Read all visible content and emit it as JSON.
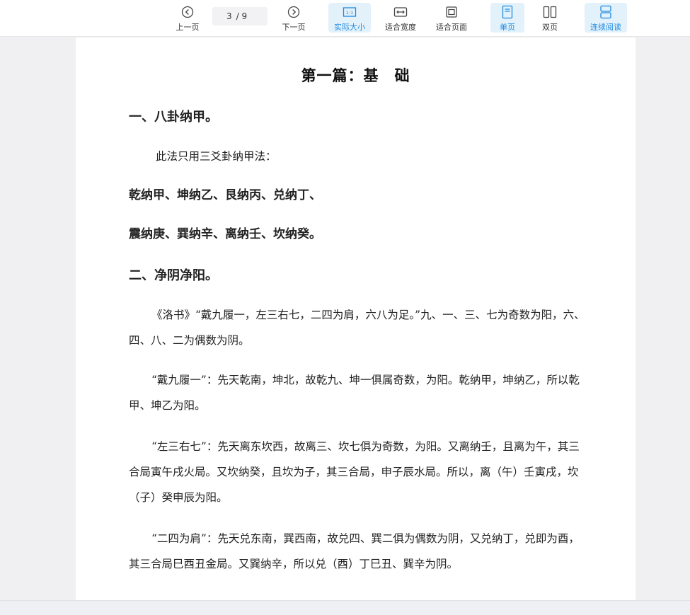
{
  "toolbar": {
    "prev_label": "上一页",
    "next_label": "下一页",
    "current_page": "3",
    "total_pages": "/ 9",
    "actual_size_label": "实际大小",
    "fit_width_label": "适合宽度",
    "fit_page_label": "适合页面",
    "single_page_label": "单页",
    "double_page_label": "双页",
    "continuous_label": "连续阅读",
    "actual_size_icon_text": "1:1",
    "accent_color": "#1e8be0"
  },
  "document": {
    "title": "第一篇：基　础",
    "section1_heading": "一、八卦纳甲。",
    "section1_intro": "此法只用三爻卦纳甲法：",
    "section1_line1": "乾纳甲、坤纳乙、艮纳丙、兑纳丁、",
    "section1_line2": "震纳庚、巽纳辛、离纳壬、坎纳癸。",
    "section2_heading": "二、净阴净阳。",
    "para1": "《洛书》“戴九履一，左三右七，二四为肩，六八为足。”九、一、三、七为奇数为阳，六、四、八、二为偶数为阴。",
    "para2": "“戴九履一”：先天乾南，坤北，故乾九、坤一俱属奇数，为阳。乾纳甲，坤纳乙，所以乾甲、坤乙为阳。",
    "para3": "“左三右七”：先天离东坎西，故离三、坎七俱为奇数，为阳。又离纳壬，且离为午，其三合局寅午戌火局。又坎纳癸，且坎为子，其三合局，申子辰水局。所以，离（午）壬寅戌，坎（子）癸申辰为阳。",
    "para4": "“二四为肩”：先天兑东南，巽西南，故兑四、巽二俱为偶数为阴，又兑纳丁，兑即为酉，其三合局巳酉丑金局。又巽纳辛，所以兑（酉）丁巳丑、巽辛为阴。"
  }
}
